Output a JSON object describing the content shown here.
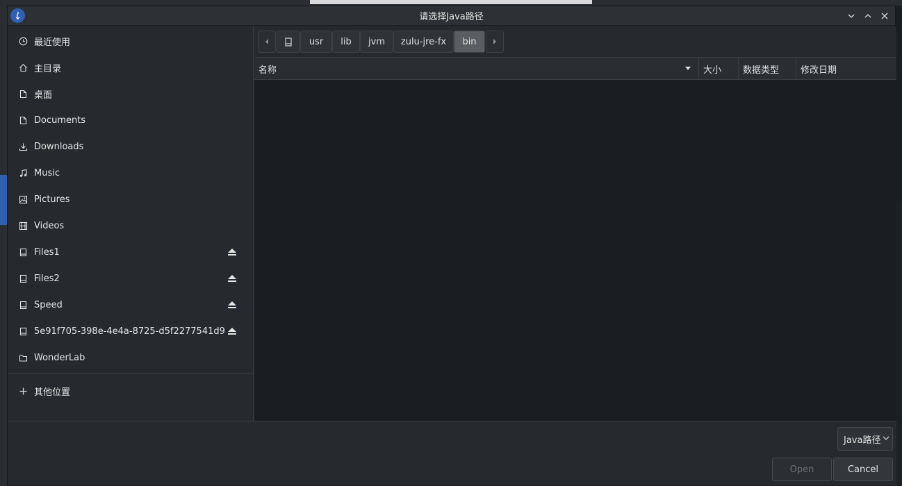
{
  "dialog": {
    "title": "请选择Java路径"
  },
  "sidebar": {
    "items": [
      {
        "label": "最近使用",
        "icon": "clock-icon",
        "eject": false
      },
      {
        "label": "主目录",
        "icon": "home-icon",
        "eject": false
      },
      {
        "label": "桌面",
        "icon": "file-icon",
        "eject": false
      },
      {
        "label": "Documents",
        "icon": "file-icon",
        "eject": false
      },
      {
        "label": "Downloads",
        "icon": "download-icon",
        "eject": false
      },
      {
        "label": "Music",
        "icon": "music-icon",
        "eject": false
      },
      {
        "label": "Pictures",
        "icon": "image-icon",
        "eject": false
      },
      {
        "label": "Videos",
        "icon": "film-icon",
        "eject": false
      },
      {
        "label": "Files1",
        "icon": "drive-icon",
        "eject": true
      },
      {
        "label": "Files2",
        "icon": "drive-icon",
        "eject": true
      },
      {
        "label": "Speed",
        "icon": "drive-icon",
        "eject": true
      },
      {
        "label": "5e91f705-398e-4e4a-8725-d5f2277541d9",
        "icon": "drive-icon",
        "eject": true
      },
      {
        "label": "WonderLab",
        "icon": "folder-icon",
        "eject": false
      }
    ],
    "other_locations": "其他位置"
  },
  "pathbar": {
    "crumbs": [
      "usr",
      "lib",
      "jvm",
      "zulu-jre-fx",
      "bin"
    ],
    "active": "bin"
  },
  "filelist": {
    "columns": {
      "name": "名称",
      "size": "大小",
      "type": "数据类型",
      "modified": "修改日期"
    }
  },
  "bottom": {
    "filter_label": "Java路径",
    "open_label": "Open",
    "cancel_label": "Cancel"
  },
  "colors": {
    "accent": "#2f5fb3",
    "background": "#26292d",
    "list_background": "#1b1e21"
  }
}
